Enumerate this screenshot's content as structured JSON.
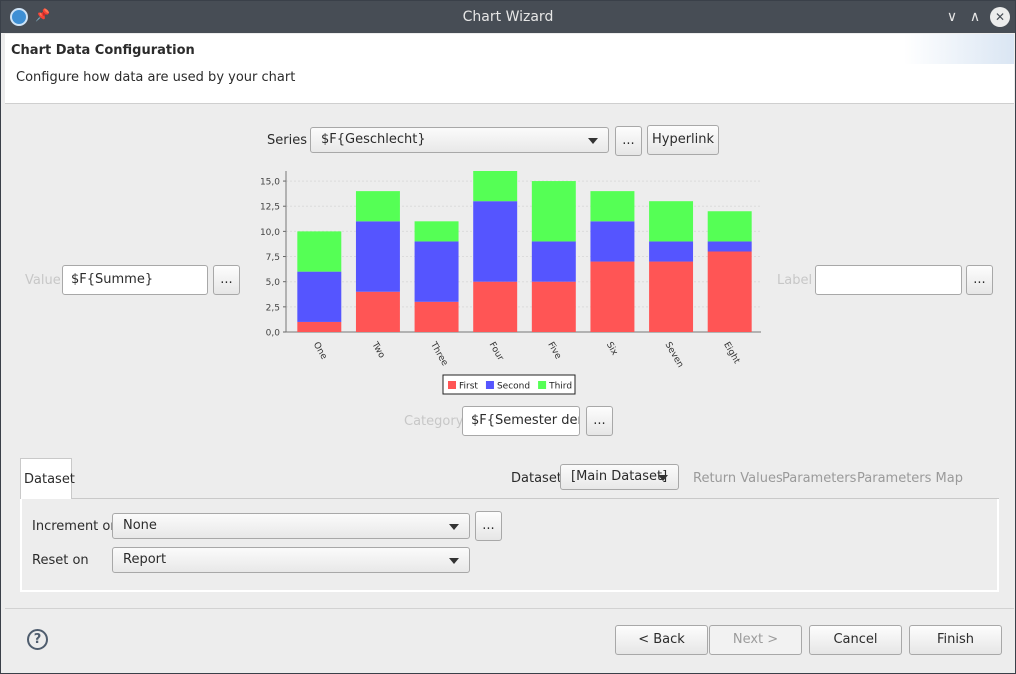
{
  "window": {
    "title": "Chart Wizard"
  },
  "header": {
    "title": "Chart Data Configuration",
    "subtitle": "Configure how data are used by your chart"
  },
  "series": {
    "label": "Series",
    "value": "$F{Geschlecht}",
    "dots": "...",
    "hyperlink": "Hyperlink"
  },
  "value_field": {
    "label": "Value",
    "value": "$F{Summe}",
    "dots": "..."
  },
  "label_field": {
    "label": "Label",
    "value": "",
    "dots": "..."
  },
  "category_field": {
    "label": "Category",
    "value": "$F{Semester der I",
    "dots": "..."
  },
  "chart_data": {
    "type": "bar",
    "stacked": true,
    "categories": [
      "One",
      "Two",
      "Three",
      "Four",
      "Five",
      "Six",
      "Seven",
      "Eight"
    ],
    "series": [
      {
        "name": "First",
        "color": "#ff5555",
        "values": [
          1,
          4,
          3,
          5,
          5,
          7,
          7,
          8
        ]
      },
      {
        "name": "Second",
        "color": "#5555ff",
        "values": [
          5,
          7,
          6,
          8,
          4,
          4,
          2,
          1
        ]
      },
      {
        "name": "Third",
        "color": "#55ff55",
        "values": [
          4,
          3,
          2,
          3,
          6,
          3,
          4,
          3
        ]
      }
    ],
    "ylim": [
      0,
      16
    ],
    "yticks": [
      "0,0",
      "2,5",
      "5,0",
      "7,5",
      "10,0",
      "12,5",
      "15,0"
    ],
    "ytick_values": [
      0,
      2.5,
      5,
      7.5,
      10,
      12.5,
      15
    ],
    "grid": true,
    "legend_position": "bottom"
  },
  "dataset_tabs": {
    "active_tab": "Dataset",
    "dataset_label": "Dataset",
    "dataset_value": "[Main Dataset]",
    "links": [
      "Return Values",
      "Parameters",
      "Parameters Map"
    ]
  },
  "increment": {
    "label": "Increment on",
    "value": "None",
    "dots": "..."
  },
  "reset": {
    "label": "Reset on",
    "value": "Report"
  },
  "footer": {
    "back": "< Back",
    "next": "Next >",
    "cancel": "Cancel",
    "finish": "Finish",
    "help": "?"
  },
  "colors": {
    "titlebar": "#474d55",
    "first": "#ff5555",
    "second": "#5555ff",
    "third": "#55ff55"
  }
}
